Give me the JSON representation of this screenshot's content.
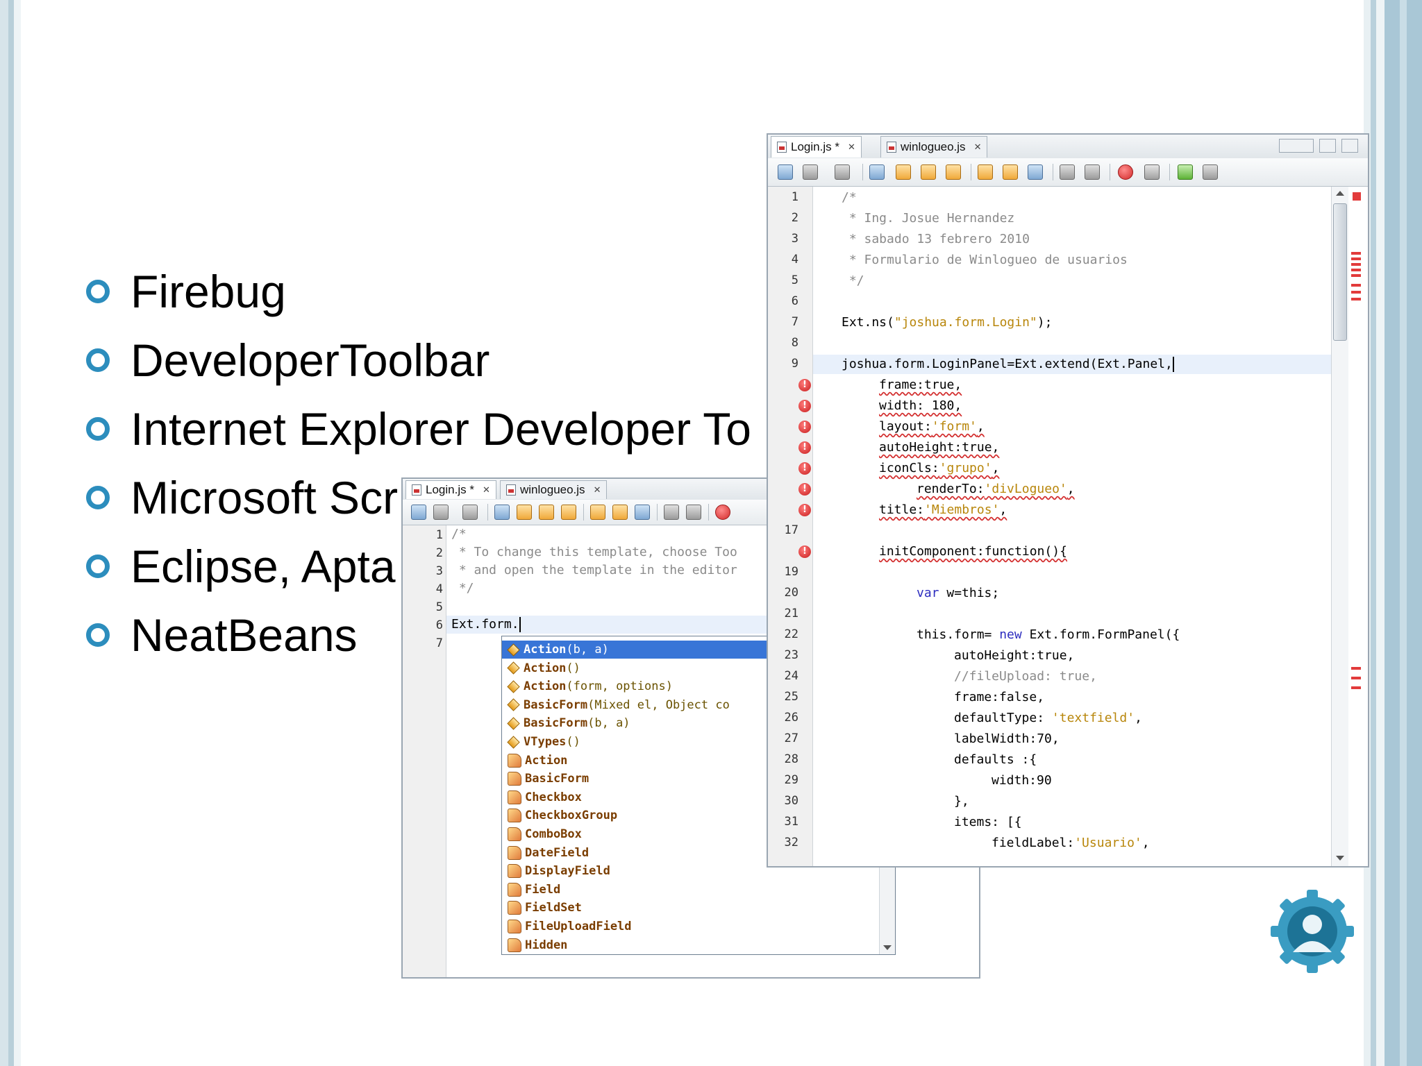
{
  "slide": {
    "bullets": [
      "Firebug",
      "DeveloperToolbar",
      "Internet Explorer Developer To",
      "Microsoft Scr",
      "Eclipse, Apta",
      "NeatBeans"
    ]
  },
  "back_editor": {
    "tabs": [
      {
        "label": "Login.js *",
        "close": "✕"
      },
      {
        "label": "winlogueo.js",
        "close": "✕"
      }
    ],
    "line_numbers": [
      "1",
      "2",
      "3",
      "4",
      "5",
      "6",
      "7"
    ],
    "lines": [
      "/*",
      " * To change this template, choose Too",
      " * and open the template in the editor",
      " */",
      "",
      "Ext.form."
    ],
    "completion": [
      {
        "kind": "method",
        "name": "Action",
        "args": "(b, a)",
        "selected": true
      },
      {
        "kind": "method",
        "name": "Action",
        "args": "()"
      },
      {
        "kind": "method",
        "name": "Action",
        "args": "(form, options)"
      },
      {
        "kind": "method",
        "name": "BasicForm",
        "args": "(Mixed el, Object co"
      },
      {
        "kind": "method",
        "name": "BasicForm",
        "args": "(b, a)"
      },
      {
        "kind": "method",
        "name": "VTypes",
        "args": "()"
      },
      {
        "kind": "class",
        "name": "Action",
        "args": ""
      },
      {
        "kind": "class",
        "name": "BasicForm",
        "args": ""
      },
      {
        "kind": "class",
        "name": "Checkbox",
        "args": ""
      },
      {
        "kind": "class",
        "name": "CheckboxGroup",
        "args": ""
      },
      {
        "kind": "class",
        "name": "ComboBox",
        "args": ""
      },
      {
        "kind": "class",
        "name": "DateField",
        "args": ""
      },
      {
        "kind": "class",
        "name": "DisplayField",
        "args": ""
      },
      {
        "kind": "class",
        "name": "Field",
        "args": ""
      },
      {
        "kind": "class",
        "name": "FieldSet",
        "args": ""
      },
      {
        "kind": "class",
        "name": "FileUploadField",
        "args": ""
      },
      {
        "kind": "class",
        "name": "Hidden",
        "args": ""
      }
    ]
  },
  "front_editor": {
    "tabs": [
      {
        "label": "Login.js *",
        "close": "✕"
      },
      {
        "label": "winlogueo.js",
        "close": "✕"
      }
    ],
    "line_numbers": [
      "1",
      "2",
      "3",
      "4",
      "5",
      "6",
      "7",
      "8",
      "9",
      "",
      "",
      "",
      "",
      "",
      "",
      "",
      "17",
      "",
      "19",
      "20",
      "21",
      "22",
      "23",
      "24",
      "25",
      "26",
      "27",
      "28",
      "29",
      "30",
      "31",
      "32"
    ],
    "error_marker": "!",
    "code": {
      "c1": "/*",
      "c2": " * Ing. Josue Hernandez",
      "c3": " * sabado 13 febrero 2010",
      "c4": " * Formulario de Winlogueo de usuarios",
      "c5": " */",
      "l7a": "Ext.ns(",
      "l7s": "\"joshua.form.Login\"",
      "l7b": ");",
      "l9": "joshua.form.LoginPanel=Ext.extend(Ext.Panel,",
      "l10": "frame:true,",
      "l11": "width: 180,",
      "l12a": "layout:",
      "l12s": "'form'",
      "l12b": ",",
      "l13": "autoHeight:true,",
      "l14a": "iconCls:",
      "l14s": "'grupo'",
      "l14b": ",",
      "l15a": "renderTo:",
      "l15s": "'divLogueo'",
      "l15b": ",",
      "l16a": "title:",
      "l16s": "'Miembros'",
      "l16b": ",",
      "l18": "initComponent:function(){",
      "l20a": "var",
      "l20b": " w=this;",
      "l22a": "this.form= ",
      "l22k": "new",
      "l22b": " Ext.form.FormPanel({",
      "l23": "autoHeight:true,",
      "l24": "//fileUpload: true,",
      "l25": "frame:false,",
      "l26a": "defaultType: ",
      "l26s": "'textfield'",
      "l26b": ",",
      "l27": "labelWidth:70,",
      "l28": "defaults :{",
      "l29": "width:90",
      "l30": "},",
      "l31": "items: [{",
      "l32a": "fieldLabel:",
      "l32s": "'Usuario'",
      "l32b": ","
    }
  },
  "colors": {
    "bullet": "#2c8dbd",
    "selection": "#3875d7",
    "string": "#b8860b",
    "comment": "#8a8a8a",
    "error": "#d32f2f"
  },
  "logo": {
    "icon": "gear-person-logo"
  }
}
